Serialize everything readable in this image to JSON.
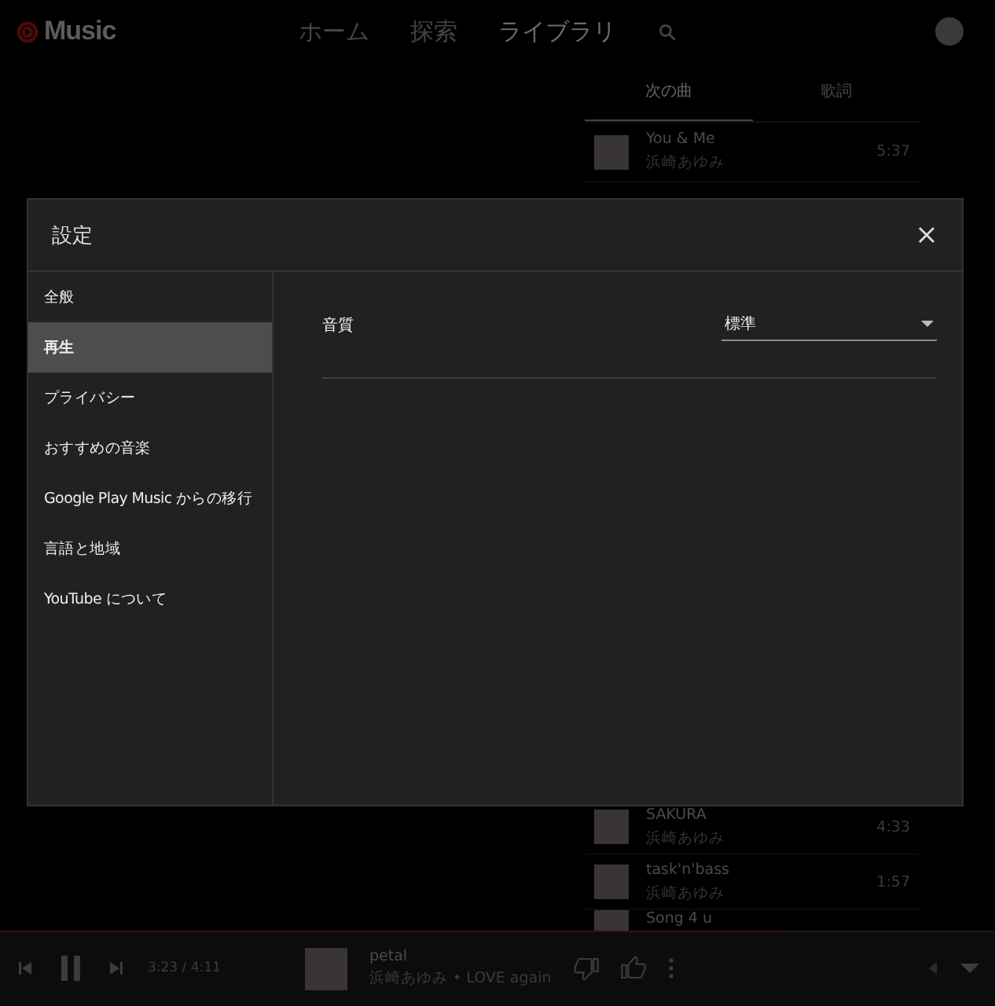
{
  "header": {
    "logo": "Music",
    "nav": [
      {
        "label": "ホーム",
        "selected": false
      },
      {
        "label": "探索",
        "selected": false
      },
      {
        "label": "ライブラリ",
        "selected": true
      }
    ]
  },
  "queue": {
    "tabs": [
      {
        "label": "次の曲",
        "selected": true
      },
      {
        "label": "歌詞",
        "selected": false
      }
    ],
    "top": [
      {
        "title": "You & Me",
        "artist": "浜崎あゆみ",
        "duration": "5:37"
      }
    ],
    "bottom": [
      {
        "title": "SAKURA",
        "artist": "浜崎あゆみ",
        "duration": "4:33"
      },
      {
        "title": "task'n'bass",
        "artist": "浜崎あゆみ",
        "duration": "1:57"
      },
      {
        "title": "Song 4 u"
      }
    ]
  },
  "player": {
    "progress": {
      "level": 0.79
    },
    "time": "3:23 / 4:11",
    "title": "petal",
    "subtitle": "浜崎あゆみ • LOVE again"
  },
  "dialog": {
    "title": "設定",
    "nav": [
      {
        "label": "全般",
        "selected": false
      },
      {
        "label": "再生",
        "selected": true
      },
      {
        "label": "プライバシー",
        "selected": false
      },
      {
        "label": "おすすめの音楽",
        "selected": false
      },
      {
        "label": "Google Play Music からの移行",
        "selected": false
      },
      {
        "label": "言語と地域",
        "selected": false
      },
      {
        "label": "YouTube について",
        "selected": false
      }
    ],
    "setting": {
      "label": "音質",
      "value": "標準"
    }
  }
}
